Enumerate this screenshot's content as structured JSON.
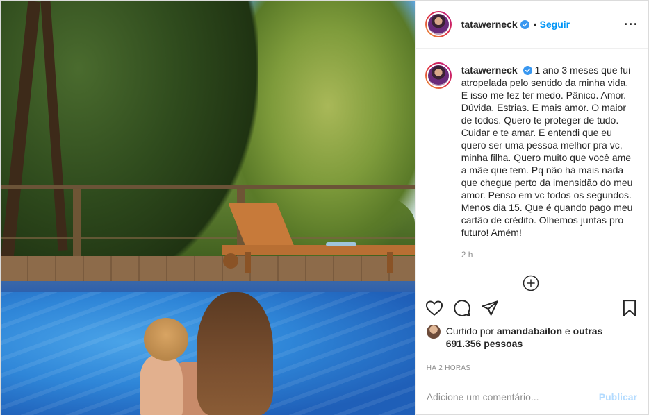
{
  "post": {
    "username": "tatawerneck",
    "verified": true,
    "separator": "•",
    "follow_label": "Seguir",
    "more_icon": "more-options-icon",
    "caption": "1 ano 3 meses que fui atropelada pelo sentido da minha vida. E isso me fez ter medo. Pânico. Amor. Dúvida. Estrias. E mais amor. O maior de todos. Quero te proteger de tudo. Cuidar e te amar. E entendi que eu quero ser uma pessoa melhor pra vc, minha filha. Quero muito que você ame a mãe que tem. Pq não há mais nada que chegue perto da imensidão do meu amor. Penso em vc todos os segundos. Menos dia 15. Que é quando pago meu cartão de crédito. Olhemos juntas pro futuro! Amém!",
    "caption_time": "2 h",
    "likes": {
      "prefix": "Curtido por",
      "liked_by": "amandabailon",
      "conjunction": "e",
      "others": "outras 691.356 pessoas"
    },
    "post_time": "HÁ 2 HORAS",
    "comment_placeholder": "Adicione um comentário...",
    "publish_label": "Publicar"
  },
  "colors": {
    "accent": "#0095f6",
    "publish_disabled": "#b3dbff",
    "muted": "#8e8e8e"
  }
}
